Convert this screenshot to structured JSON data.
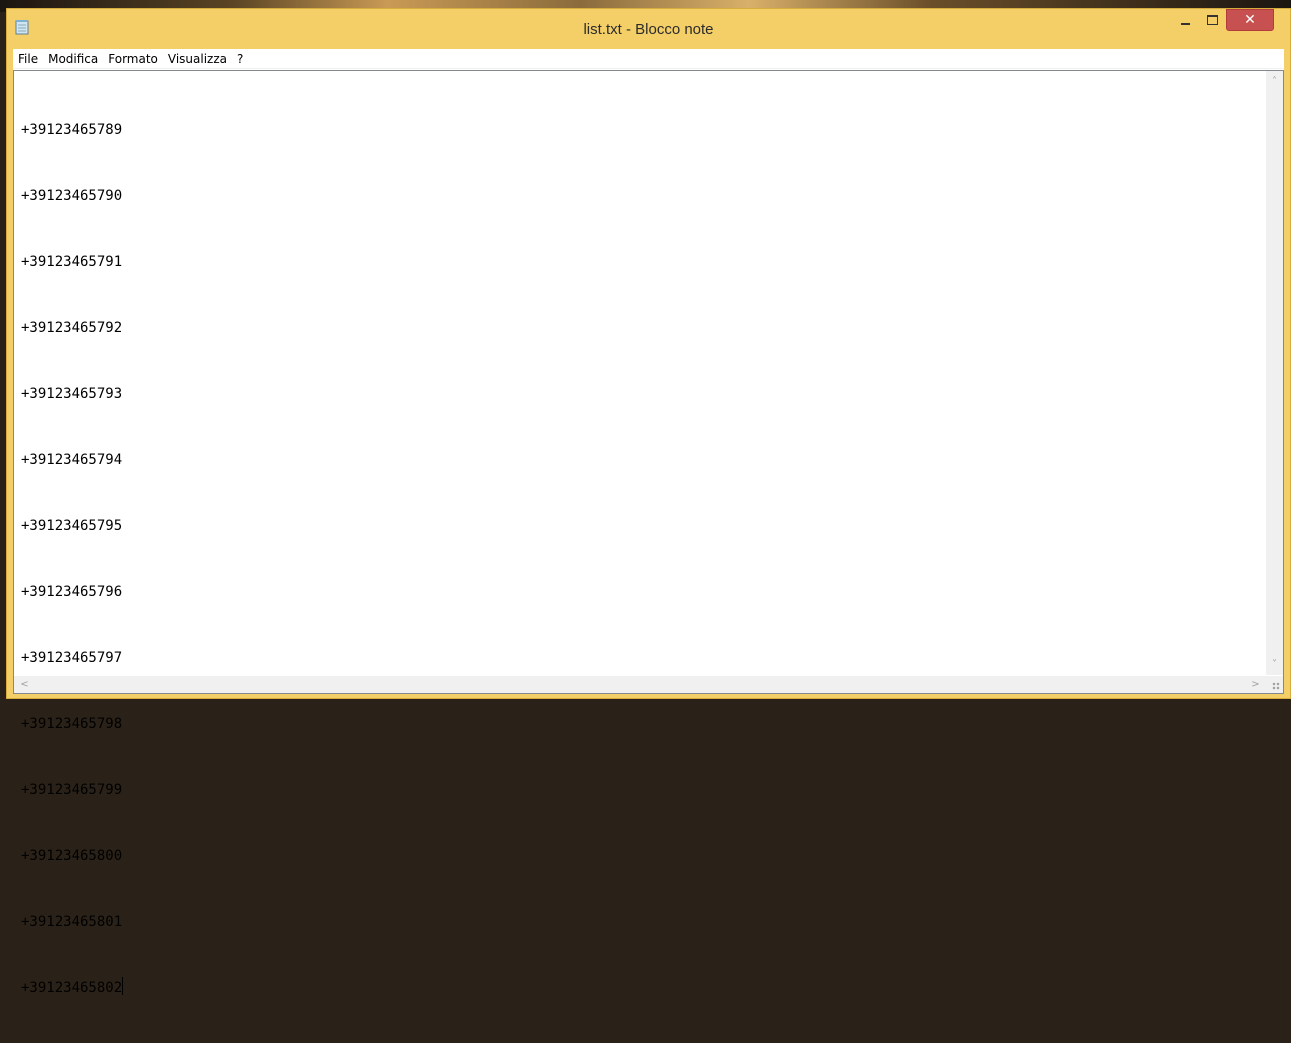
{
  "window": {
    "title": "list.txt - Blocco note",
    "accent_color": "#f4cf68",
    "close_color": "#c75050"
  },
  "caption_buttons": {
    "minimize_icon": "minimize-icon",
    "maximize_icon": "maximize-icon",
    "close_glyph": "✕"
  },
  "menu": {
    "items": [
      {
        "label": "File"
      },
      {
        "label": "Modifica"
      },
      {
        "label": "Formato"
      },
      {
        "label": "Visualizza"
      },
      {
        "label": "?"
      }
    ]
  },
  "document": {
    "lines": [
      "+39123465789",
      "+39123465790",
      "+39123465791",
      "+39123465792",
      "+39123465793",
      "+39123465794",
      "+39123465795",
      "+39123465796",
      "+39123465797",
      "+39123465798",
      "+39123465799",
      "+39123465800",
      "+39123465801",
      "+39123465802"
    ]
  },
  "scrollbars": {
    "up": "˄",
    "down": "˅",
    "left": "<",
    "right": ">"
  }
}
